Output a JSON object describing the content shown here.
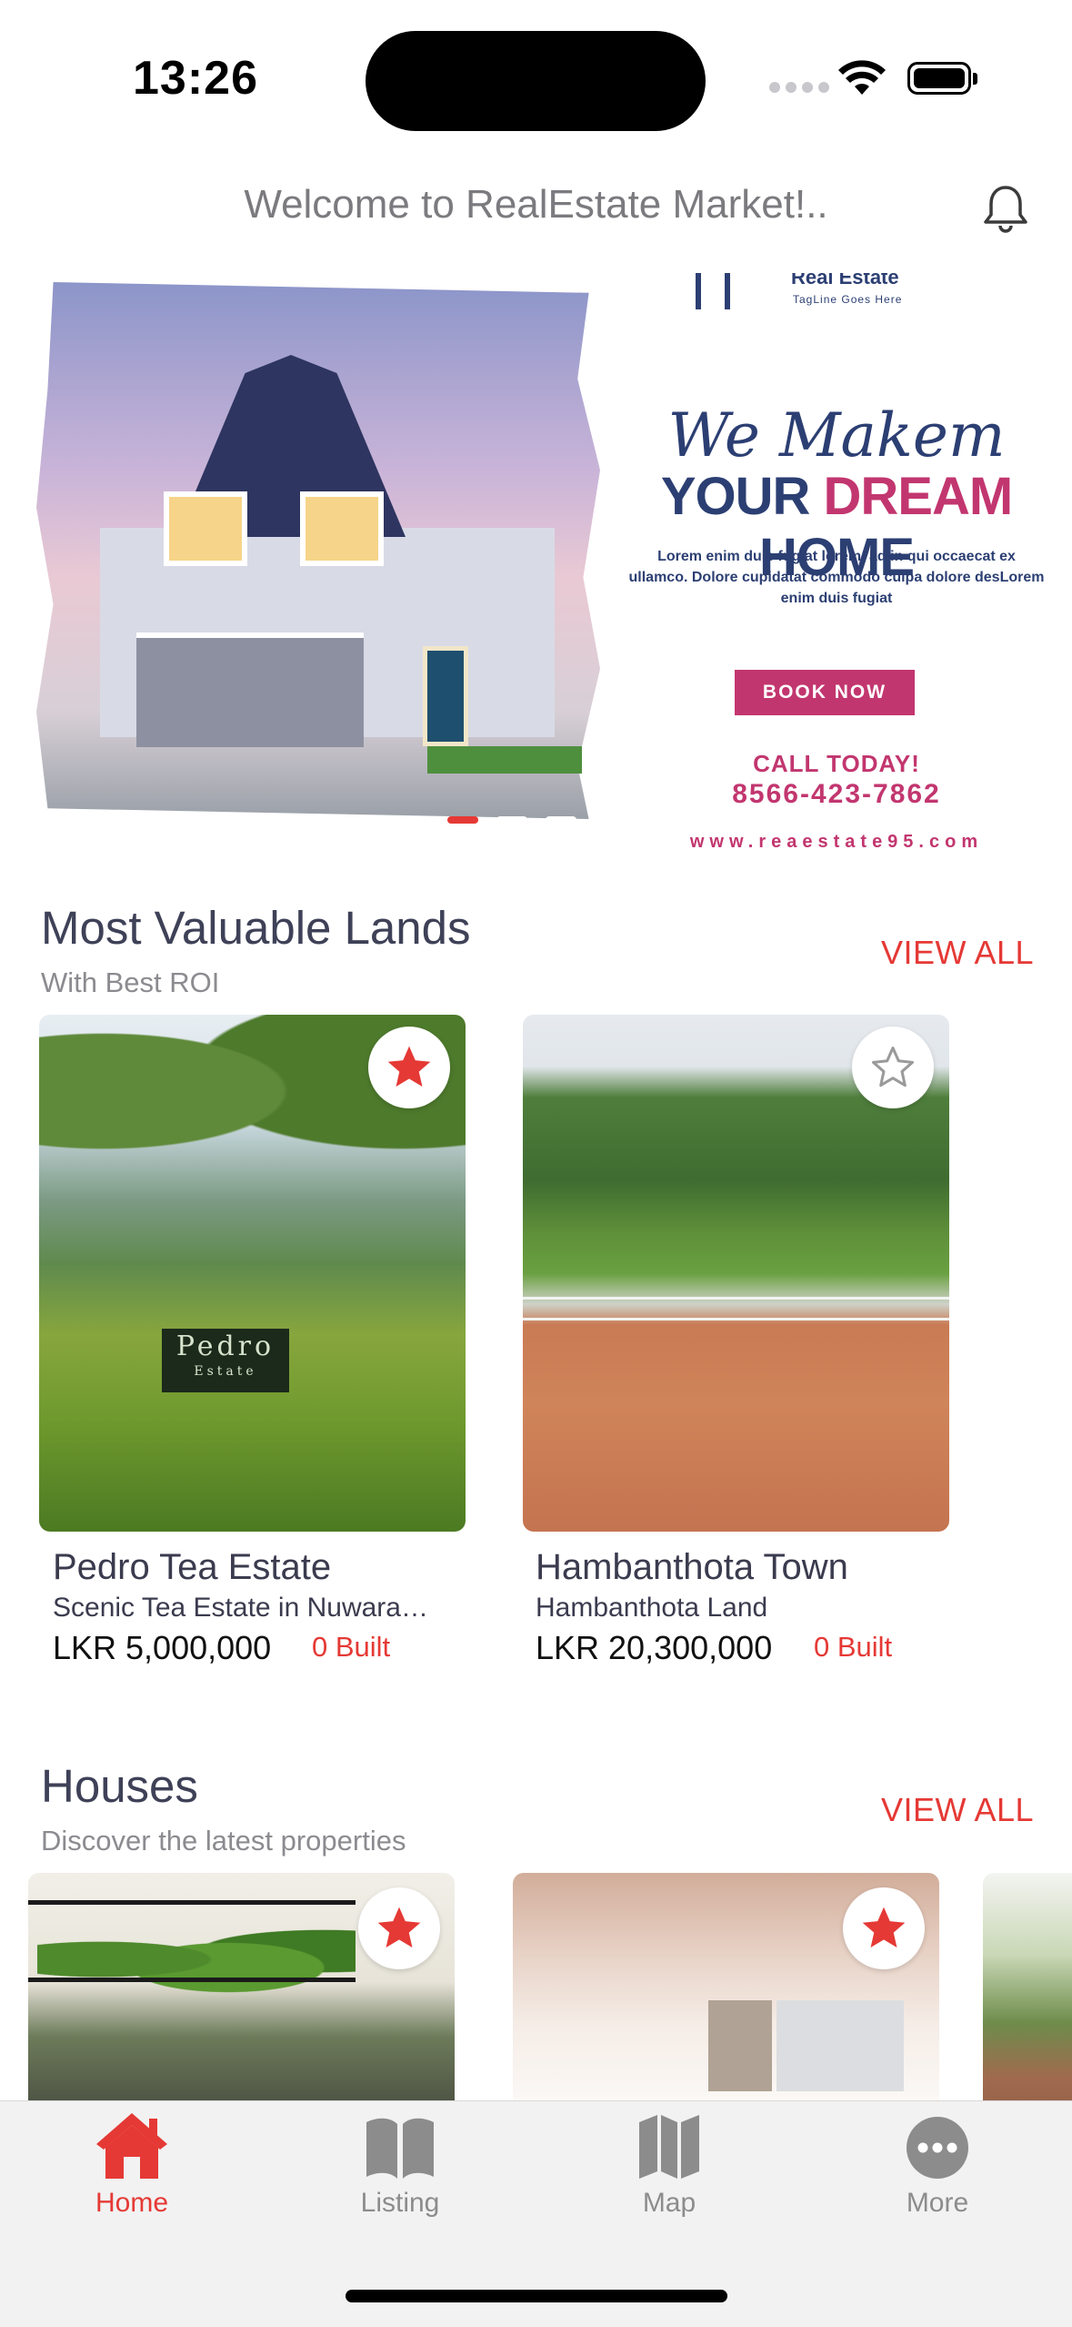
{
  "status_bar": {
    "time": "13:26"
  },
  "header": {
    "welcome": "Welcome to RealEstate Market!.."
  },
  "banner": {
    "logo_text": "Real Estate",
    "tagline": "TagLine Goes Here",
    "script": "We Makem",
    "headline_part1": "YOUR ",
    "headline_part2": "DREAM",
    "headline_part3": " HOME",
    "lorem": "Lorem enim duis fugiat lorem, ad in qui occaecat ex ullamco. Dolore cupidatat commodo culpa dolore desLorem enim duis fugiat",
    "cta": "BOOK NOW",
    "call_today": "CALL TODAY!",
    "phone": "8566-423-7862",
    "website": "www.reaestate95.com",
    "slide_count": 3,
    "active_slide": 0
  },
  "lands_section": {
    "title": "Most Valuable Lands",
    "subtitle": "With Best ROI",
    "view_all": "VIEW ALL",
    "items": [
      {
        "title": "Pedro Tea Estate",
        "subtitle": "Scenic Tea Estate in Nuwara…",
        "price": "LKR 5,000,000",
        "built": "0 Built",
        "favorite": true,
        "sign": "Pedro",
        "sign_sub": "Estate"
      },
      {
        "title": "Hambanthota Town",
        "subtitle": "Hambanthota Land",
        "price": "LKR 20,300,000",
        "built": "0 Built",
        "favorite": false
      }
    ]
  },
  "houses_section": {
    "title": "Houses",
    "subtitle": "Discover the latest properties",
    "view_all": "VIEW ALL",
    "items": [
      {
        "favorite": true
      },
      {
        "favorite": true
      },
      {
        "favorite": false
      }
    ]
  },
  "tab_bar": {
    "tabs": [
      {
        "label": "Home",
        "icon": "home-icon",
        "active": true
      },
      {
        "label": "Listing",
        "icon": "book-icon",
        "active": false
      },
      {
        "label": "Map",
        "icon": "map-icon",
        "active": false
      },
      {
        "label": "More",
        "icon": "more-icon",
        "active": false
      }
    ]
  },
  "colors": {
    "accent": "#e53935",
    "banner_navy": "#2c3f73",
    "banner_pink": "#c2366f",
    "inactive_tab": "#8c8c8c"
  }
}
